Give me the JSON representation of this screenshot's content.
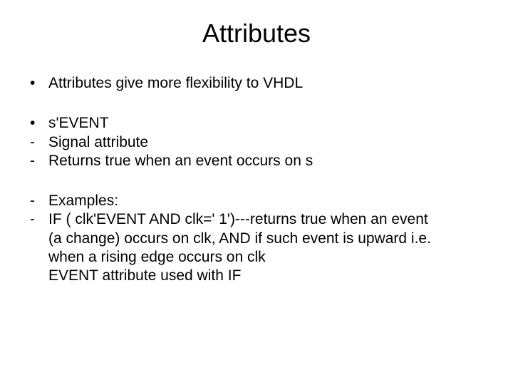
{
  "title": "Attributes",
  "groups": [
    {
      "items": [
        {
          "marker": "bullet",
          "text": "Attributes give more flexibility to VHDL"
        }
      ]
    },
    {
      "items": [
        {
          "marker": "bullet",
          "text": "s'EVENT"
        },
        {
          "marker": "dash",
          "text": "Signal attribute"
        },
        {
          "marker": "dash",
          "text": "Returns true when an event occurs on s"
        }
      ]
    },
    {
      "items": [
        {
          "marker": "dash",
          "text": "Examples:"
        },
        {
          "marker": "dash",
          "lines": [
            "IF ( clk'EVENT AND clk=' 1')---returns true when an event",
            "(a change) occurs on clk, AND if such event is upward i.e.",
            "when a rising edge occurs on clk",
            "EVENT attribute used with IF"
          ]
        }
      ]
    }
  ]
}
